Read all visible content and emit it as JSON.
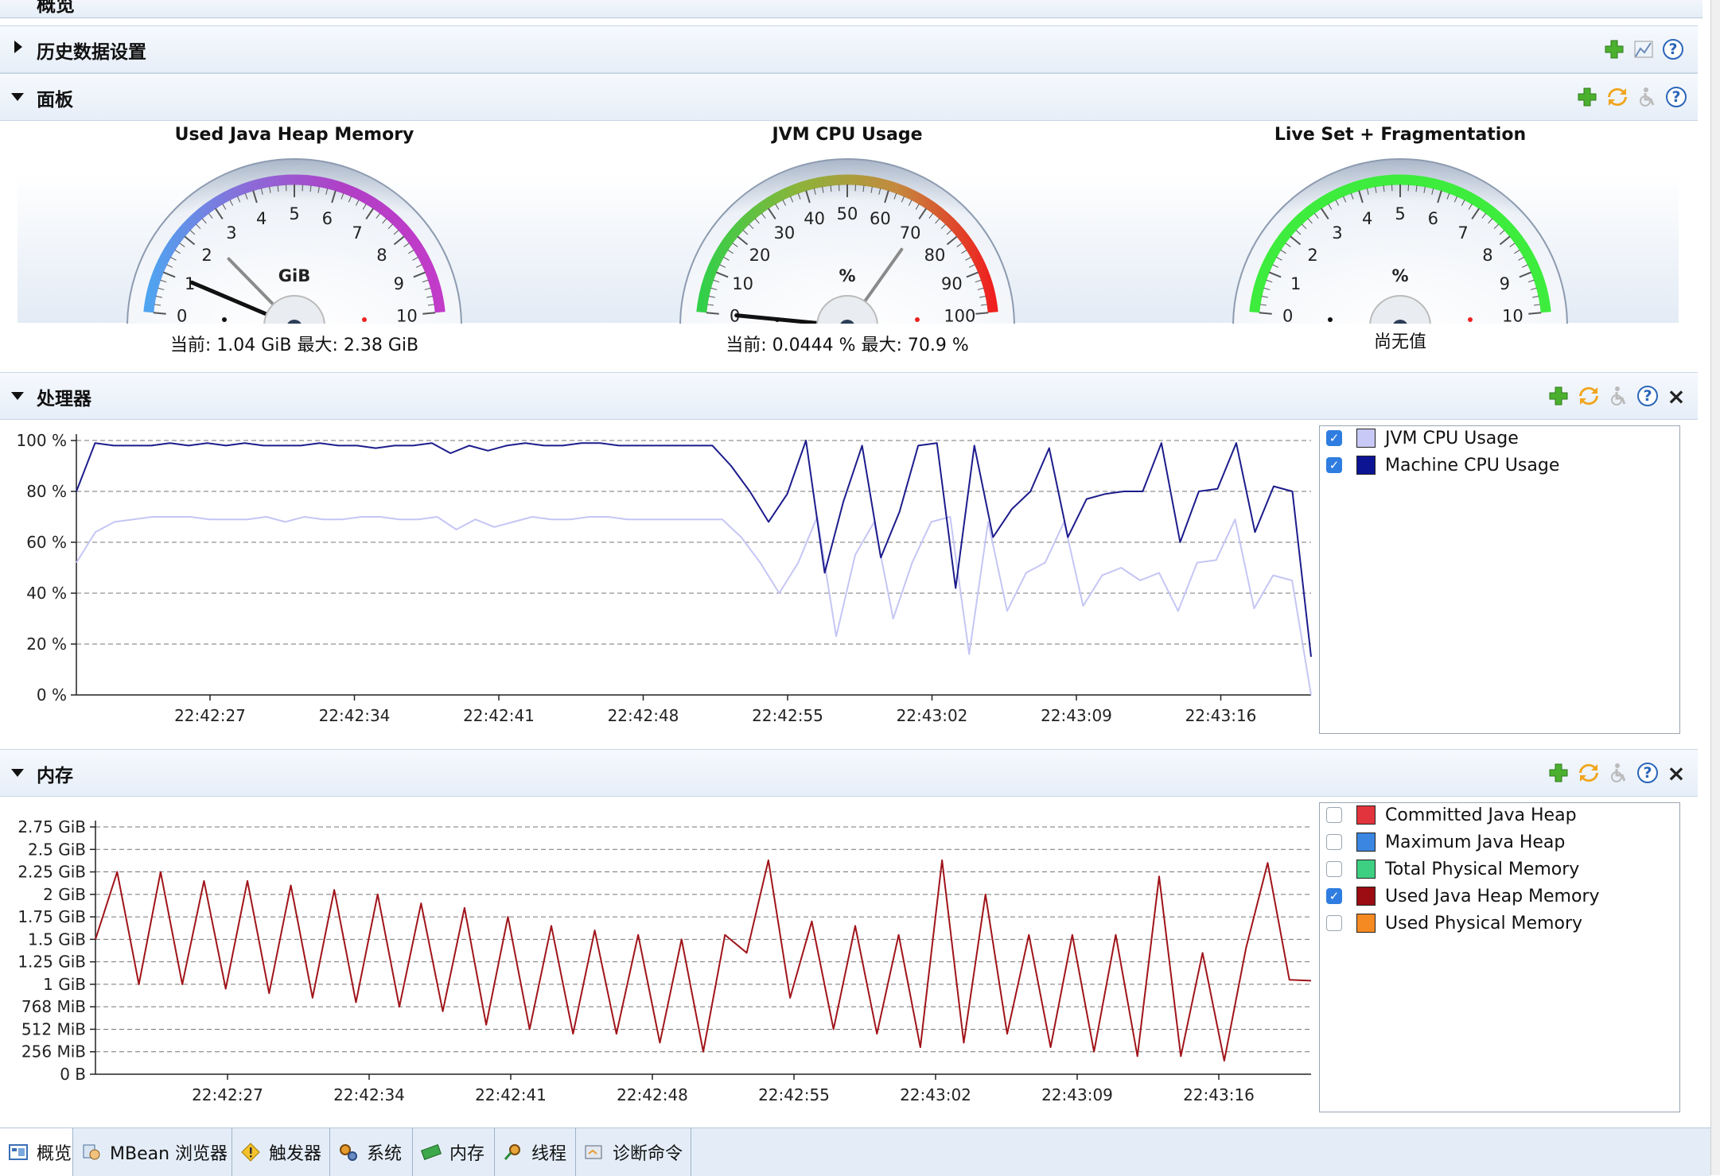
{
  "top": {
    "title": "概览"
  },
  "sections": {
    "history": {
      "label": "历史数据设置"
    },
    "dashboard": {
      "label": "面板"
    },
    "processor": {
      "label": "处理器"
    },
    "memory": {
      "label": "内存"
    }
  },
  "gauges": [
    {
      "title": "Used Java Heap Memory",
      "unit": "GiB",
      "ticks": [
        "0",
        "1",
        "2",
        "3",
        "4",
        "5",
        "6",
        "7",
        "8",
        "9",
        "10"
      ],
      "current": 1.04,
      "max": 2.38,
      "reading": "当前: 1.04 GiB    最大: 2.38 GiB"
    },
    {
      "title": "JVM CPU Usage",
      "unit": "%",
      "ticks": [
        "0",
        "10",
        "20",
        "30",
        "40",
        "50",
        "60",
        "70",
        "80",
        "90",
        "100"
      ],
      "current": 0.0444,
      "max": 70.9,
      "reading": "当前: 0.0444 %    最大: 70.9 %"
    },
    {
      "title": "Live Set + Fragmentation",
      "unit": "%",
      "ticks": [
        "0",
        "1",
        "2",
        "3",
        "4",
        "5",
        "6",
        "7",
        "8",
        "9",
        "10"
      ],
      "current": null,
      "max": null,
      "reading": "尚无值"
    }
  ],
  "chart_data": [
    {
      "type": "line",
      "x": [
        "22:42:22",
        "22:42:23",
        "22:42:24",
        "22:42:25",
        "22:42:26",
        "22:42:27",
        "22:42:28",
        "22:42:29",
        "22:42:30",
        "22:42:31",
        "22:42:32",
        "22:42:33",
        "22:42:34",
        "22:42:35",
        "22:42:36",
        "22:42:37",
        "22:42:38",
        "22:42:39",
        "22:42:40",
        "22:42:41",
        "22:42:42",
        "22:42:43",
        "22:42:44",
        "22:42:45",
        "22:42:46",
        "22:42:47",
        "22:42:48",
        "22:42:49",
        "22:42:50",
        "22:42:51",
        "22:42:52",
        "22:42:53",
        "22:42:54",
        "22:42:55",
        "22:42:56",
        "22:42:57",
        "22:42:58",
        "22:42:59",
        "22:43:00",
        "22:43:01",
        "22:43:02",
        "22:43:03",
        "22:43:04",
        "22:43:05",
        "22:43:06",
        "22:43:07",
        "22:43:08",
        "22:43:09",
        "22:43:10",
        "22:43:11",
        "22:43:12",
        "22:43:13",
        "22:43:14",
        "22:43:15",
        "22:43:16",
        "22:43:17",
        "22:43:18",
        "22:43:19",
        "22:43:20",
        "22:43:21"
      ],
      "xticks": [
        "22:42:27",
        "22:42:34",
        "22:42:41",
        "22:42:48",
        "22:42:55",
        "22:43:02",
        "22:43:09",
        "22:43:16"
      ],
      "yticks": [
        "0 %",
        "20 %",
        "40 %",
        "60 %",
        "80 %",
        "100 %"
      ],
      "ylim": [
        0,
        100
      ],
      "series": [
        {
          "name": "JVM CPU Usage",
          "color": "#c5c6f4",
          "values": [
            52,
            64,
            68,
            69,
            70,
            70,
            70,
            69,
            69,
            69,
            70,
            68,
            70,
            69,
            69,
            70,
            70,
            69,
            69,
            70,
            65,
            69,
            66,
            68,
            70,
            69,
            69,
            70,
            70,
            69,
            69,
            69,
            69,
            69,
            69,
            62,
            52,
            40,
            52,
            70,
            23,
            55,
            68,
            30,
            52,
            68,
            70,
            16,
            68,
            33,
            48,
            52,
            68,
            35,
            47,
            50,
            45,
            48,
            33,
            52,
            53,
            69,
            34,
            47,
            45,
            0
          ]
        },
        {
          "name": "Machine CPU Usage",
          "color": "#1c1c8c",
          "values": [
            80,
            99,
            98,
            98,
            98,
            99,
            98,
            99,
            98,
            99,
            98,
            98,
            98,
            99,
            98,
            98,
            97,
            98,
            98,
            99,
            95,
            98,
            96,
            98,
            99,
            98,
            98,
            99,
            99,
            98,
            98,
            98,
            98,
            98,
            98,
            90,
            80,
            68,
            79,
            100,
            48,
            76,
            98,
            54,
            72,
            98,
            99,
            42,
            98,
            62,
            73,
            80,
            97,
            62,
            77,
            79,
            80,
            80,
            99,
            60,
            80,
            81,
            99,
            64,
            82,
            80,
            15
          ]
        }
      ]
    },
    {
      "type": "line",
      "xticks": [
        "22:42:27",
        "22:42:34",
        "22:42:41",
        "22:42:48",
        "22:42:55",
        "22:43:02",
        "22:43:09",
        "22:43:16"
      ],
      "yticks": [
        "0 B",
        "256 MiB",
        "512 MiB",
        "768 MiB",
        "1 GiB",
        "1.25 GiB",
        "1.5 GiB",
        "1.75 GiB",
        "2 GiB",
        "2.25 GiB",
        "2.5 GiB",
        "2.75 GiB"
      ],
      "ylim": [
        0,
        2.75
      ],
      "yunit": "GiB",
      "series": [
        {
          "name": "Committed Java Heap",
          "color": "#e23a3a",
          "visible": false,
          "values": []
        },
        {
          "name": "Maximum Java Heap",
          "color": "#3a87e0",
          "visible": false,
          "values": []
        },
        {
          "name": "Total Physical Memory",
          "color": "#3fd07a",
          "visible": false,
          "values": []
        },
        {
          "name": "Used Java Heap Memory",
          "color": "#a0141a",
          "visible": true,
          "values": [
            1.5,
            2.25,
            1.0,
            2.25,
            1.0,
            2.15,
            0.95,
            2.15,
            0.9,
            2.1,
            0.85,
            2.05,
            0.8,
            2.0,
            0.75,
            1.9,
            0.7,
            1.85,
            0.55,
            1.75,
            0.5,
            1.65,
            0.45,
            1.6,
            0.45,
            1.55,
            0.35,
            1.5,
            0.25,
            1.55,
            1.35,
            2.38,
            0.85,
            1.7,
            0.5,
            1.65,
            0.45,
            1.55,
            0.3,
            2.38,
            0.35,
            2.0,
            0.45,
            1.55,
            0.3,
            1.55,
            0.25,
            1.55,
            0.2,
            2.2,
            0.2,
            1.35,
            0.15,
            1.4,
            2.35,
            1.05,
            1.04
          ]
        },
        {
          "name": "Used Physical Memory",
          "color": "#f58a1f",
          "visible": false,
          "values": []
        }
      ]
    }
  ],
  "legend_cpu": [
    {
      "label": "JVM CPU Usage",
      "checked": true,
      "color": "#c9c9f7"
    },
    {
      "label": "Machine CPU Usage",
      "checked": true,
      "color": "#0d1494"
    }
  ],
  "legend_mem": [
    {
      "label": "Committed Java Heap",
      "checked": false,
      "color": "#e2343d"
    },
    {
      "label": "Maximum Java Heap",
      "checked": false,
      "color": "#3a86e0"
    },
    {
      "label": "Total Physical Memory",
      "checked": false,
      "color": "#3ed082"
    },
    {
      "label": "Used Java Heap Memory",
      "checked": true,
      "color": "#9b0d12"
    },
    {
      "label": "Used Physical Memory",
      "checked": false,
      "color": "#f58a22"
    }
  ],
  "tabs": [
    {
      "label": "概览",
      "icon": "overview-icon"
    },
    {
      "label": "MBean 浏览器",
      "icon": "mbean-browser-icon"
    },
    {
      "label": "触发器",
      "icon": "trigger-icon"
    },
    {
      "label": "系统",
      "icon": "system-icon"
    },
    {
      "label": "内存",
      "icon": "memory-icon"
    },
    {
      "label": "线程",
      "icon": "threads-icon"
    },
    {
      "label": "诊断命令",
      "icon": "diagnostic-commands-icon"
    }
  ]
}
